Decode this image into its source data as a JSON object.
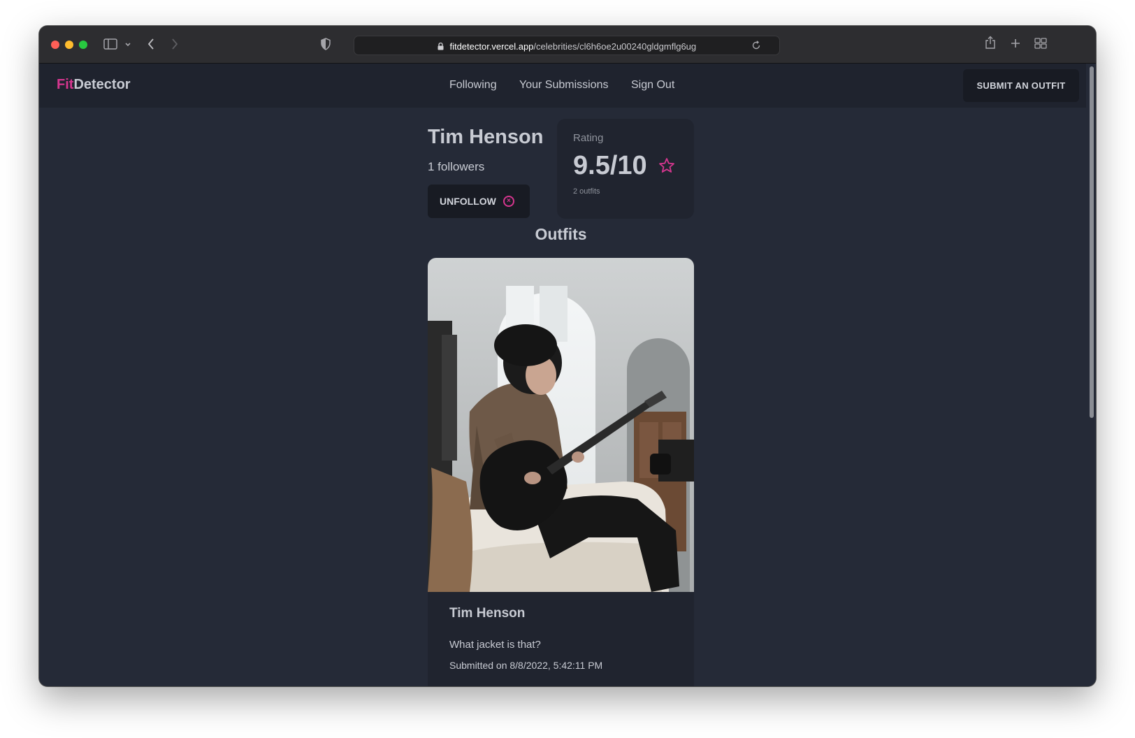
{
  "browser": {
    "url_domain": "fitdetector.vercel.app",
    "url_path": "/celebrities/cl6h6oe2u00240gldgmflg6ug",
    "traffic_colors": [
      "#ff5f57",
      "#febc2e",
      "#28c840"
    ]
  },
  "navbar": {
    "logo_accent": "Fit",
    "logo_rest": "Detector",
    "links": [
      "Following",
      "Your Submissions",
      "Sign Out"
    ],
    "submit_label": "SUBMIT AN OUTFIT",
    "accent_color": "#d6368f"
  },
  "profile": {
    "name": "Tim Henson",
    "followers": "1 followers",
    "unfollow_label": "UNFOLLOW"
  },
  "rating": {
    "label": "Rating",
    "value": "9.5/10",
    "outfits_count": "2 outfits"
  },
  "outfits": {
    "heading": "Outfits",
    "items": [
      {
        "name": "Tim Henson",
        "caption": "What jacket is that?",
        "submitted": "Submitted on 8/8/2022, 5:42:11 PM"
      }
    ]
  }
}
